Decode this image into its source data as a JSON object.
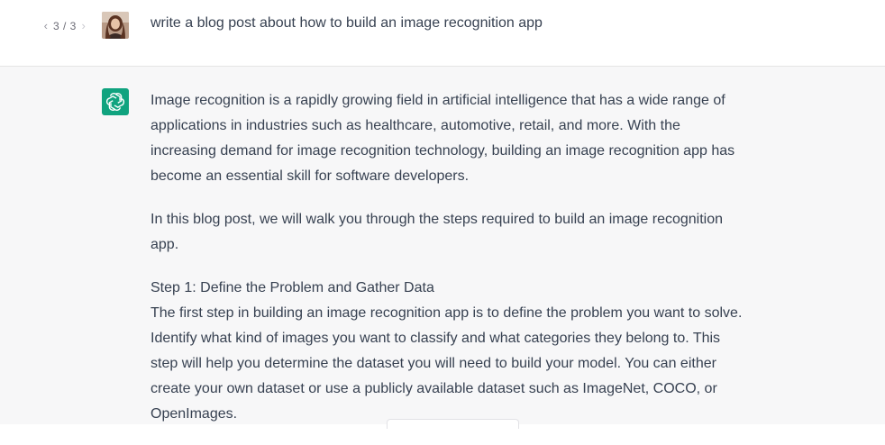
{
  "user_message": {
    "pager": {
      "prev_icon": "chevron-left-icon",
      "position": "3 / 3",
      "next_icon": "chevron-right-icon"
    },
    "avatar_icon": "user-avatar",
    "text": "write a blog post about how to build an image recognition app"
  },
  "assistant_message": {
    "logo_icon": "openai-logo-icon",
    "paragraphs": [
      "Image recognition is a rapidly growing field in artificial intelligence that has a wide range of applications in industries such as healthcare, automotive, retail, and more. With the increasing demand for image recognition technology, building an image recognition app has become an essential skill for software developers.",
      "In this blog post, we will walk you through the steps required to build an image recognition app.",
      "Step 1: Define the Problem and Gather Data",
      "The first step in building an image recognition app is to define the problem you want to solve. Identify what kind of images you want to classify and what categories they belong to. This step will help you determine the dataset you will need to build your model. You can either create your own dataset or use a publicly available dataset such as ImageNet, COCO, or OpenImages."
    ]
  },
  "colors": {
    "page_bg": "#ffffff",
    "assistant_bg": "#f7f7f8",
    "text": "#374151",
    "brand": "#10a37f"
  }
}
